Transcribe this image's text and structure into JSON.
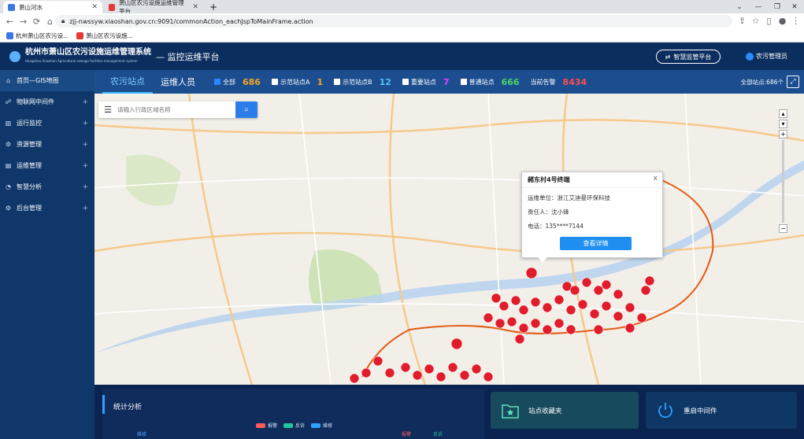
{
  "browser": {
    "tabs": [
      {
        "title": "萧山河水",
        "favicon_color": "#3b78e7"
      },
      {
        "title": "萧山区农污设施运维管理平台",
        "favicon_color": "#e53935"
      }
    ],
    "new_tab": "+",
    "url": "zjj-nwssyw.xiaoshan.gov.cn:9091/commonAction_eachJspToMainFrame.action",
    "bookmarks": [
      {
        "label": "杭州萧山区农污设...",
        "color": "#3b78e7"
      },
      {
        "label": "萧山区农污设施...",
        "color": "#e53935"
      }
    ]
  },
  "header": {
    "system_name": "杭州市萧山区农污设施运维管理系统",
    "system_name_en": "Hangzhou Xiaoshan Agricultural sewage facilities management system",
    "platform": "— 监控运维平台",
    "smart_button": "智慧监管平台",
    "user": "农污管理员"
  },
  "sidebar": {
    "items": [
      {
        "label": "首页—GIS地图",
        "icon": "home-icon",
        "expandable": false
      },
      {
        "label": "物联网中间件",
        "icon": "iot-icon",
        "expandable": true
      },
      {
        "label": "运行监控",
        "icon": "monitor-icon",
        "expandable": true
      },
      {
        "label": "资源管理",
        "icon": "resource-icon",
        "expandable": true
      },
      {
        "label": "运维管理",
        "icon": "maintenance-icon",
        "expandable": true
      },
      {
        "label": "智慧分析",
        "icon": "analysis-icon",
        "expandable": true
      },
      {
        "label": "后台管理",
        "icon": "settings-icon",
        "expandable": true
      }
    ]
  },
  "filter": {
    "tabs": [
      "农污站点",
      "运维人员"
    ],
    "checks": [
      {
        "label": "全部",
        "count": "686",
        "checked": true,
        "color": "#f5a623"
      },
      {
        "label": "示范站点A",
        "count": "1",
        "checked": false,
        "color": "#f5a623"
      },
      {
        "label": "示范站点B",
        "count": "12",
        "checked": false,
        "color": "#4fc3f7"
      },
      {
        "label": "重要站点",
        "count": "7",
        "checked": false,
        "color": "#e040fb"
      },
      {
        "label": "普通站点",
        "count": "666",
        "checked": false,
        "color": "#4cd964"
      }
    ],
    "alarm_label": "当前告警",
    "alarm_count": "8434",
    "alarm_color": "#ff4d4f",
    "all_sites": "全部站点:686个"
  },
  "map": {
    "search_placeholder": "请输入行政区域名称",
    "popup": {
      "title": "赭东村4号终端",
      "unit": "运维单位：浙江艾迪曼环保科技",
      "person": "责任人：沈小锋",
      "phone": "电话：135****7144",
      "button": "查看详情",
      "close": "x"
    }
  },
  "bottom": {
    "stats_title": "统计分析",
    "legend": [
      {
        "label": "报警",
        "color": "#ff5a5a"
      },
      {
        "label": "反诉",
        "color": "#21c79a"
      },
      {
        "label": "维修",
        "color": "#2fa0ff"
      }
    ],
    "columns": [
      "维修",
      "报警",
      "反诉"
    ],
    "fav_label": "站点收藏夹",
    "restart_label": "重启中间件"
  }
}
